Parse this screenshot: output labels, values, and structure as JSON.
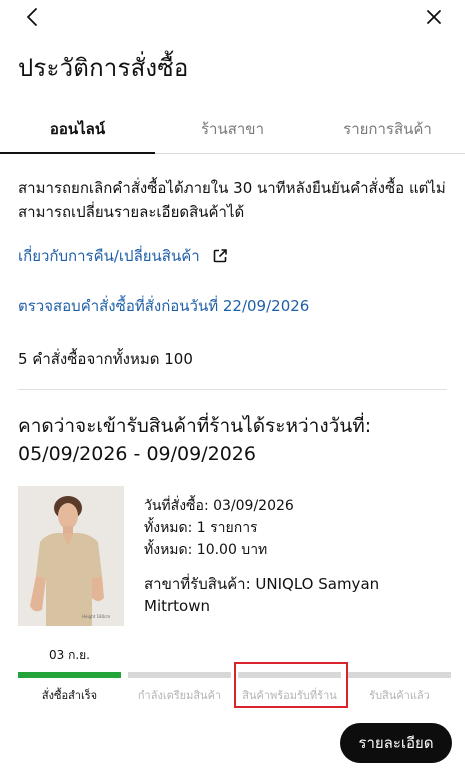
{
  "header": {
    "back_icon": "chevron-left-icon",
    "close_icon": "close-icon",
    "title": "ประวัติการสั่งซื้อ"
  },
  "tabs": [
    {
      "label": "ออนไลน์",
      "active": true
    },
    {
      "label": "ร้านสาขา",
      "active": false
    },
    {
      "label": "รายการสินค้า",
      "active": false
    }
  ],
  "notice": "สามารถยกเลิกคำสั่งซื้อได้ภายใน 30 นาทีหลังยืนยันคำสั่งซื้อ แต่ไม่สามารถเปลี่ยนรายละเอียดสินค้าได้",
  "links": {
    "returns_label": "เกี่ยวกับการคืน/เปลี่ยนสินค้า",
    "returns_icon": "external-link-icon",
    "check_orders_label": "ตรวจสอบคำสั่งซื้อที่สั่งก่อนวันที่ 22/09/2026"
  },
  "order_count": "5 คำสั่งซื้อจากทั้งหมด 100",
  "order": {
    "pickup_heading_line1": "คาดว่าจะเข้ารับสินค้าที่ร้านได้ระหว่างวันที่:",
    "pickup_heading_line2": "05/09/2026 - 09/09/2026",
    "order_date": "วันที่สั่งซื้อ: 03/09/2026",
    "total_items": "ทั้งหมด: 1 รายการ",
    "total_amount": "ทั้งหมด: 10.00 บาท",
    "store": "สาขาที่รับสินค้า: UNIQLO Samyan Mitrtown"
  },
  "progress": {
    "steps": [
      {
        "date": "03 ก.ย.",
        "label": "สั่งซื้อสำเร็จ",
        "done": true
      },
      {
        "date": "",
        "label": "กำลังเตรียมสินค้า",
        "done": false
      },
      {
        "date": "",
        "label": "สินค้าพร้อมรับที่ร้าน",
        "done": false
      },
      {
        "date": "",
        "label": "รับสินค้าแล้ว",
        "done": false
      }
    ],
    "done_color": "#23a33a",
    "pending_color": "#d8d8d8",
    "highlight_color": "#d9232d"
  },
  "detail_button": "รายละเอียด"
}
